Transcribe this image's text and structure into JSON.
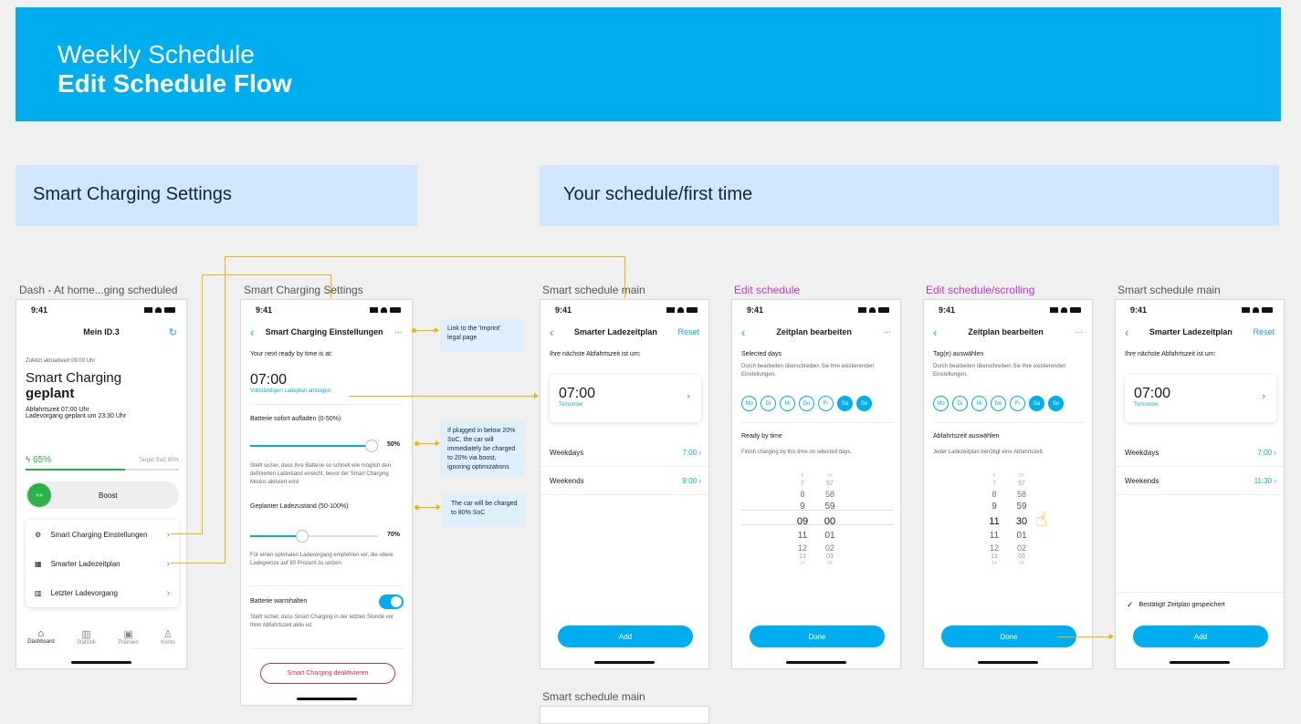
{
  "banner": {
    "line1": "Weekly Schedule",
    "line2": "Edit Schedule Flow"
  },
  "sections": {
    "left": "Smart Charging Settings",
    "right": "Your schedule/first time"
  },
  "frames": {
    "f1": "Dash - At home...ging scheduled",
    "f2": "Smart Charging Settings",
    "f3": "Smart schedule main",
    "f4": "Edit schedule",
    "f5": "Edit schedule/scrolling",
    "f6": "Smart schedule main",
    "f7": "Smart schedule main"
  },
  "status_time": "9:41",
  "dash": {
    "title": "Mein ID.3",
    "updated": "Zuletzt aktualisiert 09:00 Uhr",
    "heading1": "Smart Charging",
    "heading2": "geplant",
    "dep": "Abfahrtszeit 07:00 Uhr",
    "planned": "Ladevorgang geplant um 23:30 Uhr",
    "soc": "65%",
    "target": "Target SoC 80%",
    "boost_icon": "»»",
    "boost": "Boost",
    "menu": [
      "Smart Charging Einstellungen",
      "Smarter Ladezeitplan",
      "Letzter Ladevorgang"
    ],
    "tabs": [
      "Dashboard",
      "Statistik",
      "Prämien",
      "Konto"
    ]
  },
  "settings": {
    "title": "Smart Charging Einstellungen",
    "more": "···",
    "next": "Your next ready by time is at:",
    "time": "07:00",
    "link": "Vollständigen Ladeplan anzeigen",
    "s1_label": "Batterie sofort aufladen (0-50%)",
    "s1_value": "50%",
    "s1_desc": "Stellt sicher, dass Ihre Batterie so schnell wie möglich den definierten Ladestand erreicht, bevor der Smart Charging Modus aktiviert wird",
    "s2_label": "Geplanter Ladezustand (50-100%)",
    "s2_value": "70%",
    "s2_desc": "Für einen optimalen Ladevorgang empfehlen wir, die obere Ladegrenze auf 80 Prozent zu setzen.",
    "warm_label": "Batterie warmhalten",
    "warm_desc": "Stellt sicher, dass Smart Charging in der letzten Stunde vor Ihrer Abfahrtszeit aktiv ist.",
    "deactivate": "Smart Charging deaktivieren"
  },
  "notes": [
    "Link to the 'Imprint' legal page",
    "If plugged in below 20% SoC, the car will immediately be charged to 20% via boost, ignoring optimizations",
    "The car will be charged to 80% SoC"
  ],
  "schedule": {
    "title": "Smarter Ladezeitplan",
    "reset": "Reset",
    "next": "Ihre nächste Abfahrtszeit ist um:",
    "time": "07:00",
    "tomorrow": "Tomorrow",
    "weekdays": "Weekdays",
    "weekdays_time": "7:00",
    "weekends": "Weekends",
    "weekends_time": "9:00",
    "weekends_time2": "11:30",
    "add": "Add",
    "confirm": "Bestätigt! Zeitplan gespeichert"
  },
  "edit": {
    "title": "Zeitplan bearbeiten",
    "more": "···",
    "sel_en": "Selected days",
    "sel_de": "Tag(e) auswählen",
    "override": "Durch bearbeiten überschreiben Sie Ihre existierenden Einstellungen.",
    "days": [
      "Mo",
      "Di",
      "Mi",
      "Do",
      "Fr",
      "Sa",
      "So"
    ],
    "ready_en": "Ready by time",
    "finish_en": "Finish charging by this time on selected days.",
    "ready_de": "Abfahrtszeit auswählen",
    "finish_de": "Jeder Ladezeitplan benötigt eine Abfahrtszeit.",
    "hours_a": [
      "6",
      "7",
      "8",
      "9",
      "09",
      "11",
      "12",
      "13",
      "14"
    ],
    "mins_a": [
      "56",
      "57",
      "58",
      "59",
      "00",
      "01",
      "02",
      "03",
      "04"
    ],
    "hours_b": [
      "6",
      "7",
      "8",
      "9",
      "11",
      "11",
      "12",
      "13",
      "14"
    ],
    "mins_b": [
      "56",
      "57",
      "58",
      "59",
      "30",
      "01",
      "02",
      "03",
      "04"
    ],
    "done": "Done"
  },
  "colors": {
    "accent": "#00aef0",
    "connector": "#f4b400",
    "section": "#cfe6fb",
    "label_pink": "#c333d6"
  }
}
